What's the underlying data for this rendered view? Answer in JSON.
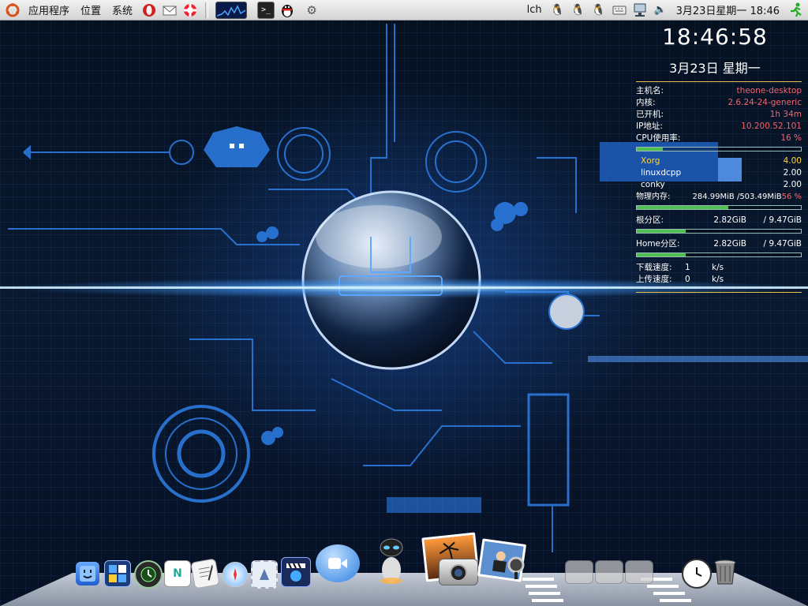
{
  "top_panel": {
    "menus": [
      "应用程序",
      "位置",
      "系统"
    ],
    "user": "lch",
    "datetime": "3月23日星期一 18:46"
  },
  "conky": {
    "time": "18:46:58",
    "date": "3月23日 星期一",
    "system": [
      {
        "label": "主机名:",
        "value": "theone-desktop"
      },
      {
        "label": "内核:",
        "value": "2.6.24-24-generic"
      },
      {
        "label": "已开机:",
        "value": "1h 34m"
      },
      {
        "label": "IP地址:",
        "value": "10.200.52.101"
      },
      {
        "label": "CPU使用率:",
        "value": "16 %"
      }
    ],
    "cpu_percent": 16,
    "processes": [
      {
        "name": "Xorg",
        "value": "4.00"
      },
      {
        "name": "linuxdcpp",
        "value": "2.00"
      },
      {
        "name": "conky",
        "value": "2.00"
      }
    ],
    "memory": {
      "label": "物理内存:",
      "used": "284.99MiB",
      "total": "/503.49MiB",
      "percent": "56 %",
      "fraction": 0.56
    },
    "root": {
      "label": "根分区:",
      "used": "2.82GiB",
      "total": "/ 9.47GiB",
      "fraction": 0.3
    },
    "home": {
      "label": "Home分区:",
      "used": "2.82GiB",
      "total": "/ 9.47GiB",
      "fraction": 0.3
    },
    "down": {
      "label": "下载速度:",
      "value": "1",
      "unit": "k/s"
    },
    "up": {
      "label": "上传速度:",
      "value": "0",
      "unit": "k/s"
    }
  },
  "colors": {
    "accent": "#2f7bff",
    "panel": "#e0e0e0",
    "bar": "#4fbf4f",
    "value": "#f4646f"
  }
}
